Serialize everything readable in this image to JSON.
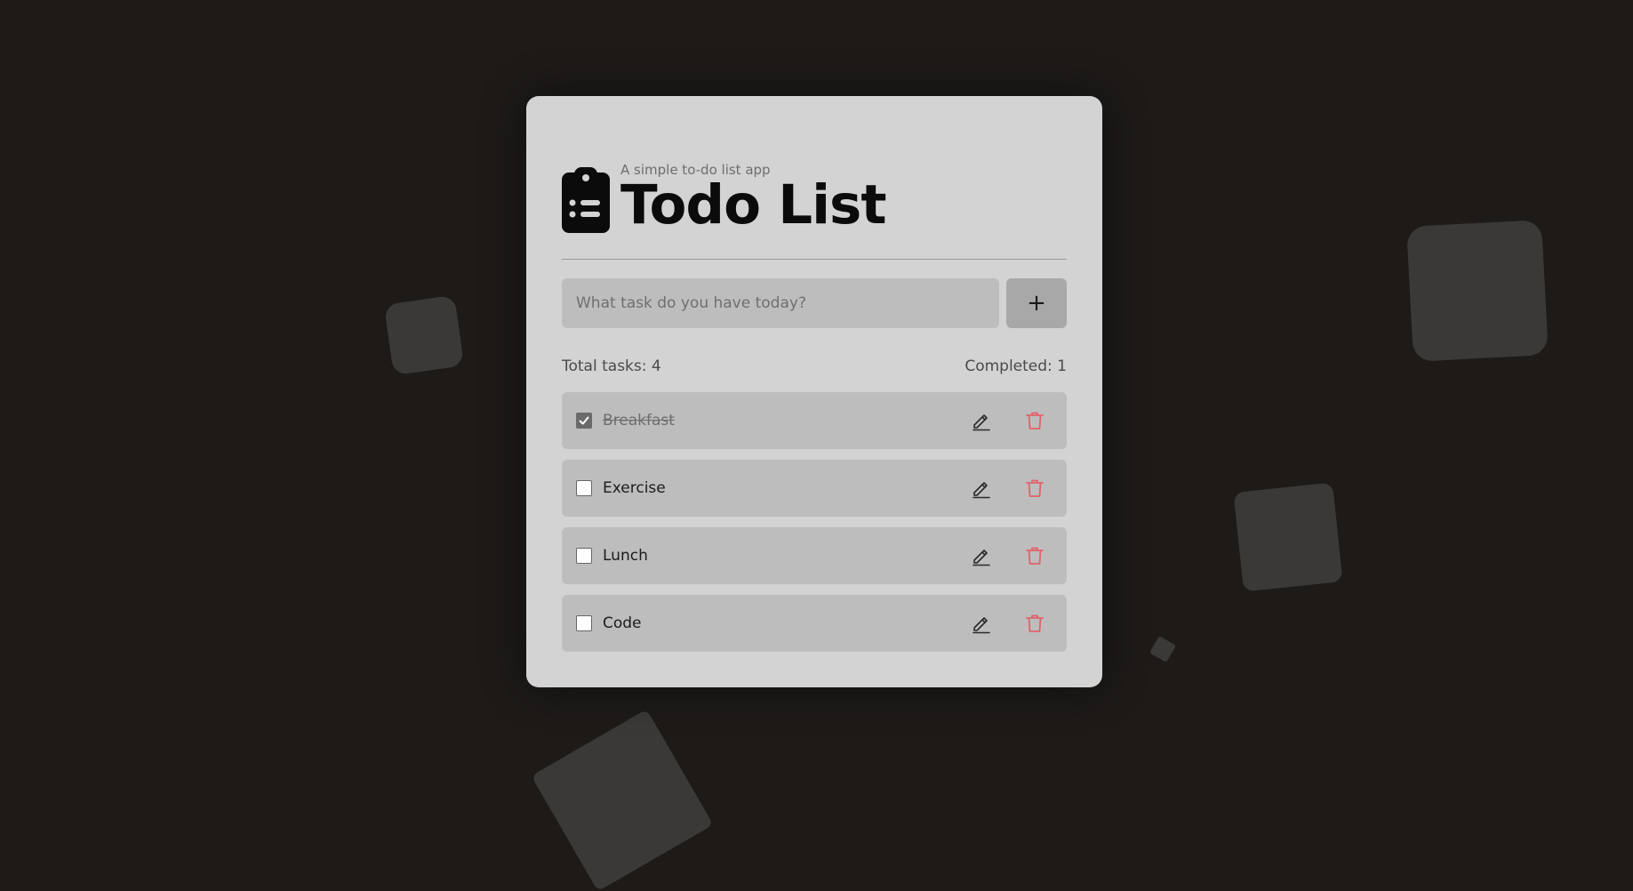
{
  "app": {
    "subtitle": "A simple to-do list app",
    "title": "Todo List"
  },
  "input": {
    "placeholder": "What task do you have today?",
    "value": ""
  },
  "add_button": {
    "label": "+",
    "icon": "plus-icon"
  },
  "stats": {
    "total_label": "Total tasks: 4",
    "completed_label": "Completed: 1"
  },
  "tasks": [
    {
      "label": "Breakfast",
      "completed": true
    },
    {
      "label": "Exercise",
      "completed": false
    },
    {
      "label": "Lunch",
      "completed": false
    },
    {
      "label": "Code",
      "completed": false
    }
  ],
  "colors": {
    "background": "#1d1a18",
    "card": "#d3d3d3",
    "row": "#bdbdbd",
    "delete_accent": "#e2626a",
    "decor": "#3b3938"
  },
  "icons": {
    "logo": "clipboard-list-icon",
    "edit": "pencil-icon",
    "delete": "trash-icon",
    "check": "checkmark-icon"
  }
}
